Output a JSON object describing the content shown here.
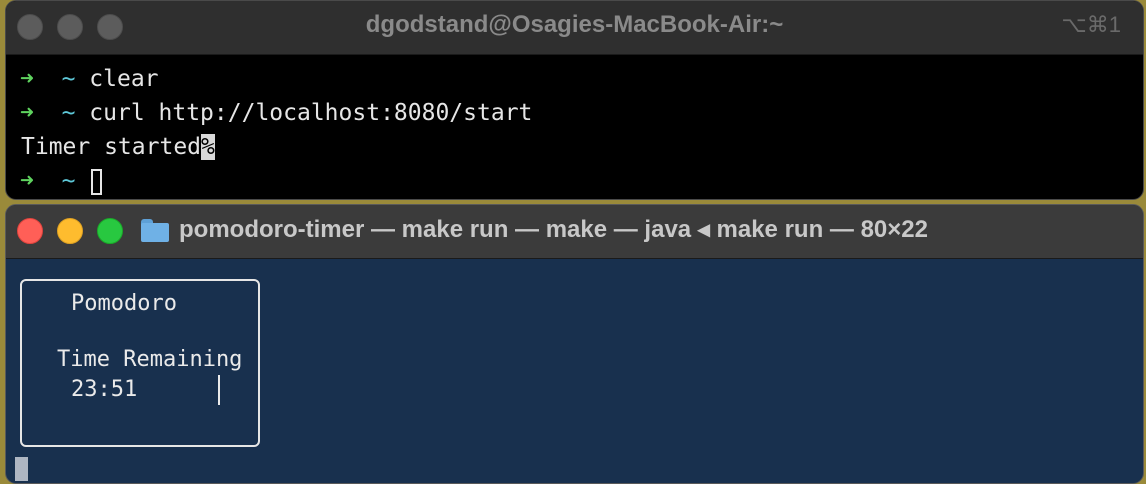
{
  "window_top": {
    "title": "dgodstand@Osagies-MacBook-Air:~",
    "shortcut": "⌥⌘1",
    "lines": [
      {
        "prompt_arrow": "➜",
        "prompt_dir": "~",
        "command": "clear"
      },
      {
        "prompt_arrow": "➜",
        "prompt_dir": "~",
        "command": "curl http://localhost:8080/start"
      },
      {
        "output": "Timer started",
        "output_marker": "%"
      },
      {
        "prompt_arrow": "➜",
        "prompt_dir": "~",
        "command": ""
      }
    ]
  },
  "window_bottom": {
    "title": "pomodoro-timer — make run — make — java ◂ make run — 80×22",
    "icon": "folder-icon",
    "tui": {
      "title": "Pomodoro",
      "label": "Time Remaining",
      "time": "23:51"
    }
  },
  "colors": {
    "prompt_arrow": "#5fd35f",
    "prompt_dir": "#5ec8d8",
    "terminal_bg_top": "#000000",
    "terminal_bg_bottom": "#18304e",
    "traffic_red": "#ff5f57",
    "traffic_yellow": "#febc2e",
    "traffic_green": "#28c840"
  }
}
